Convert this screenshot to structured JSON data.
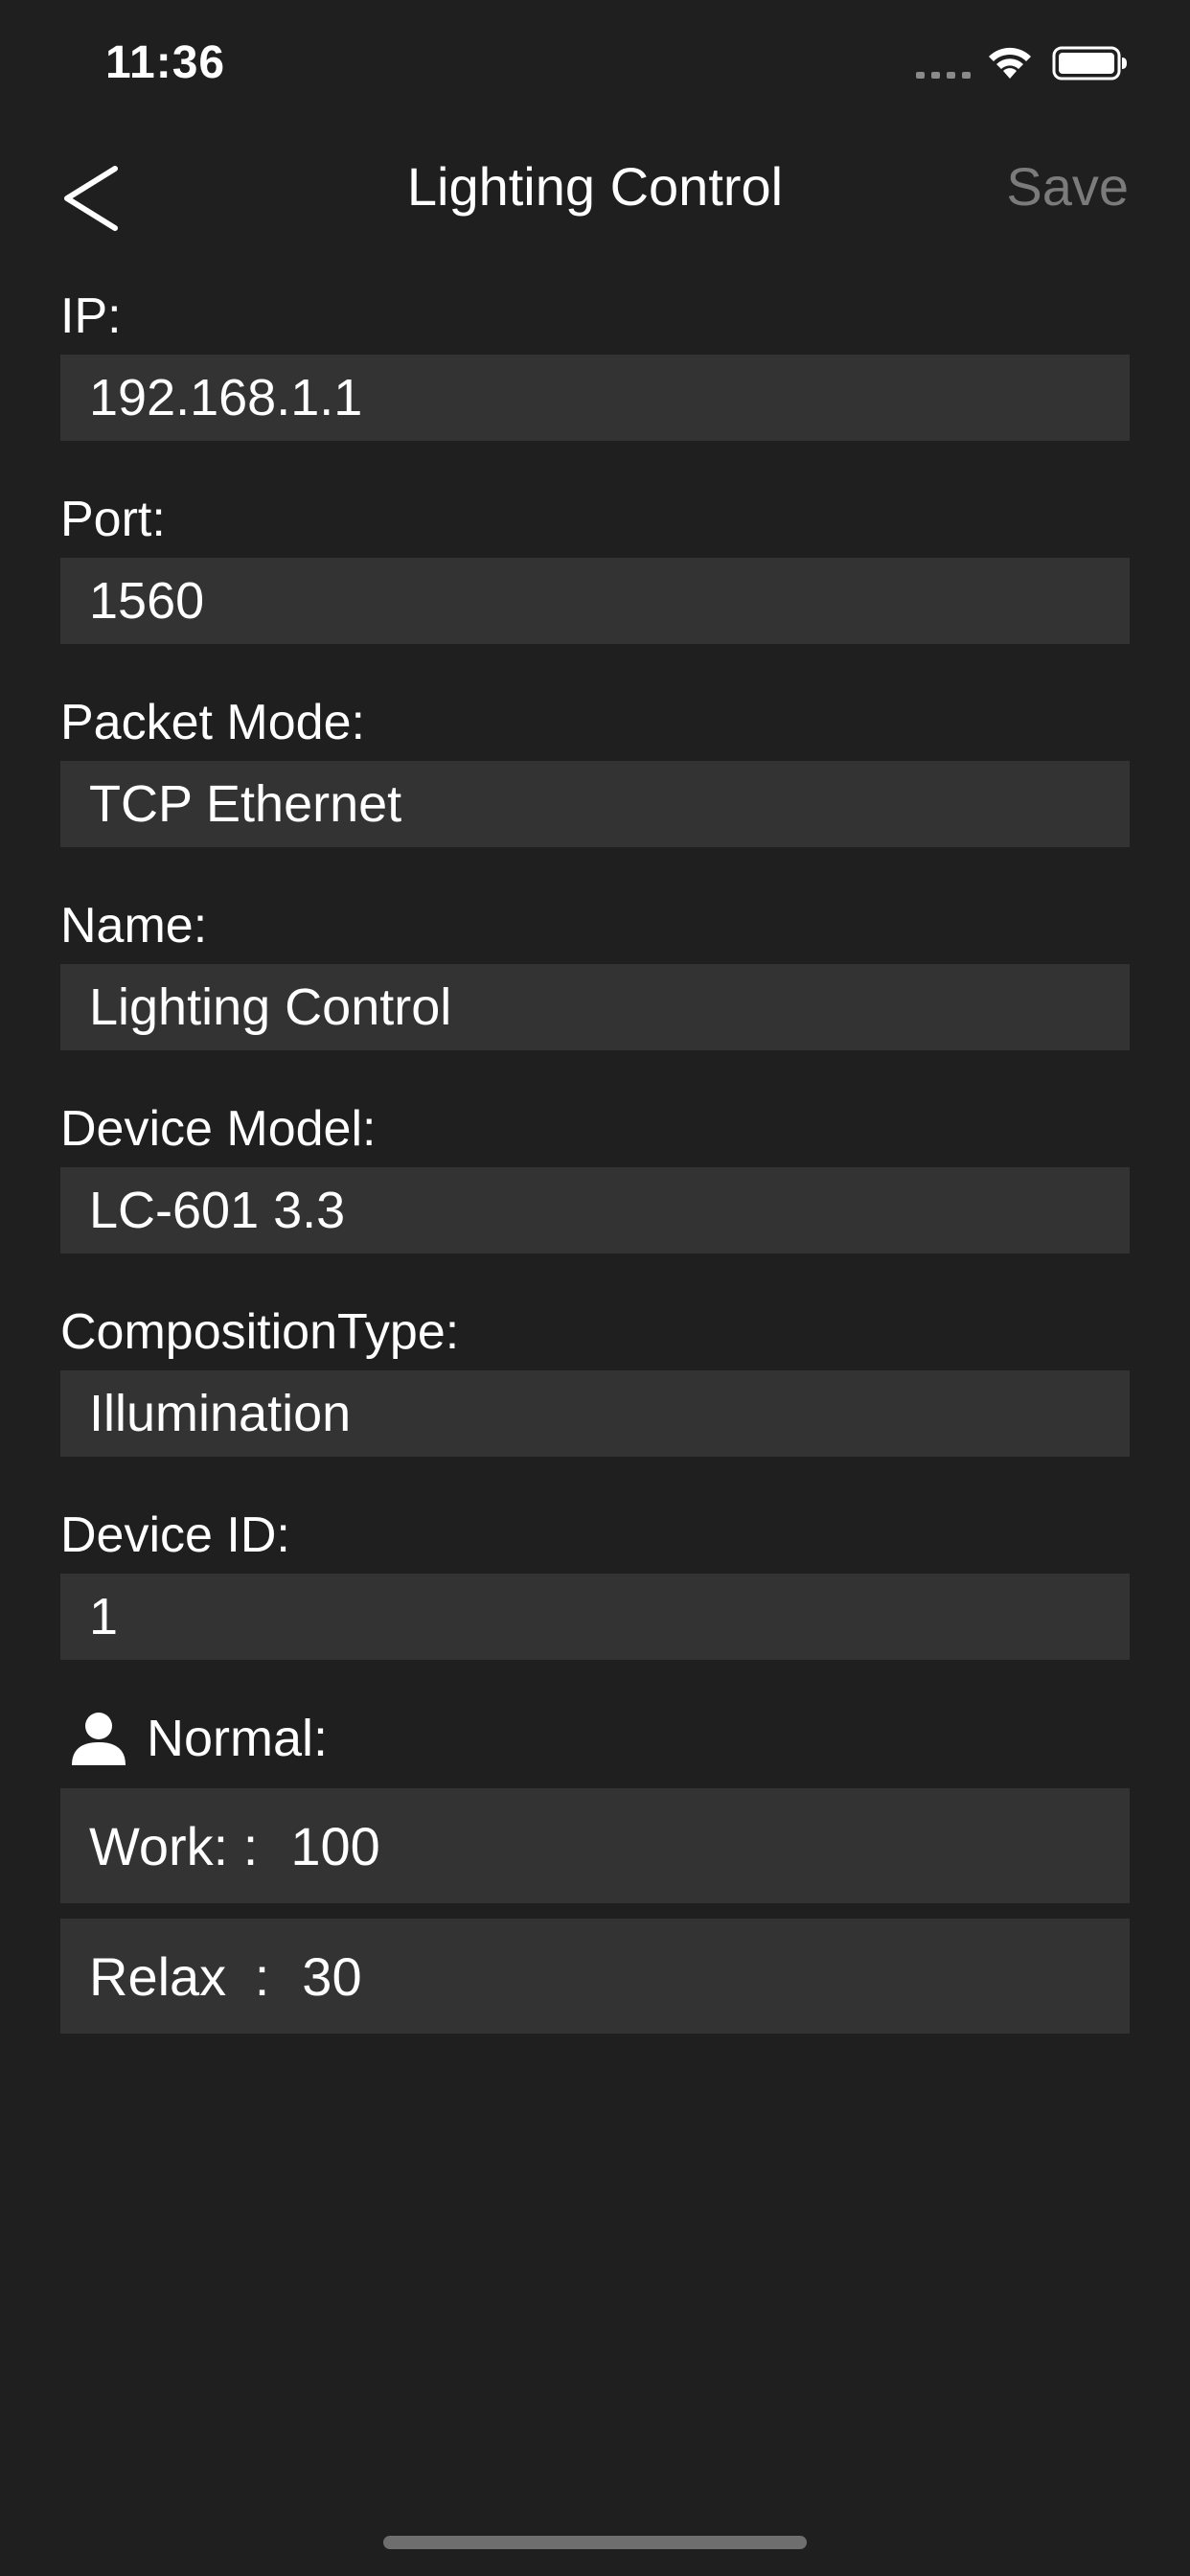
{
  "status_bar": {
    "time": "11:36"
  },
  "nav": {
    "title": "Lighting Control",
    "save_label": "Save",
    "back_icon": "chevron-left-icon"
  },
  "fields": [
    {
      "label": "IP:",
      "value": "192.168.1.1"
    },
    {
      "label": "Port:",
      "value": "1560"
    },
    {
      "label": "Packet Mode:",
      "value": "TCP Ethernet"
    },
    {
      "label": "Name:",
      "value": "Lighting Control"
    },
    {
      "label": "Device Model:",
      "value": "LC-601 3.3"
    },
    {
      "label": "CompositionType:",
      "value": "Illumination"
    },
    {
      "label": "Device ID:",
      "value": "1"
    }
  ],
  "modes_section": {
    "icon": "person-icon",
    "title": "Normal:",
    "items": [
      {
        "name": "Work: ",
        "sep": ":",
        "value": "100"
      },
      {
        "name": "Relax ",
        "sep": ":",
        "value": "30"
      }
    ]
  },
  "colors": {
    "background": "#1f1f1f",
    "field_background": "#333333",
    "save_disabled": "#7b7b7b"
  }
}
